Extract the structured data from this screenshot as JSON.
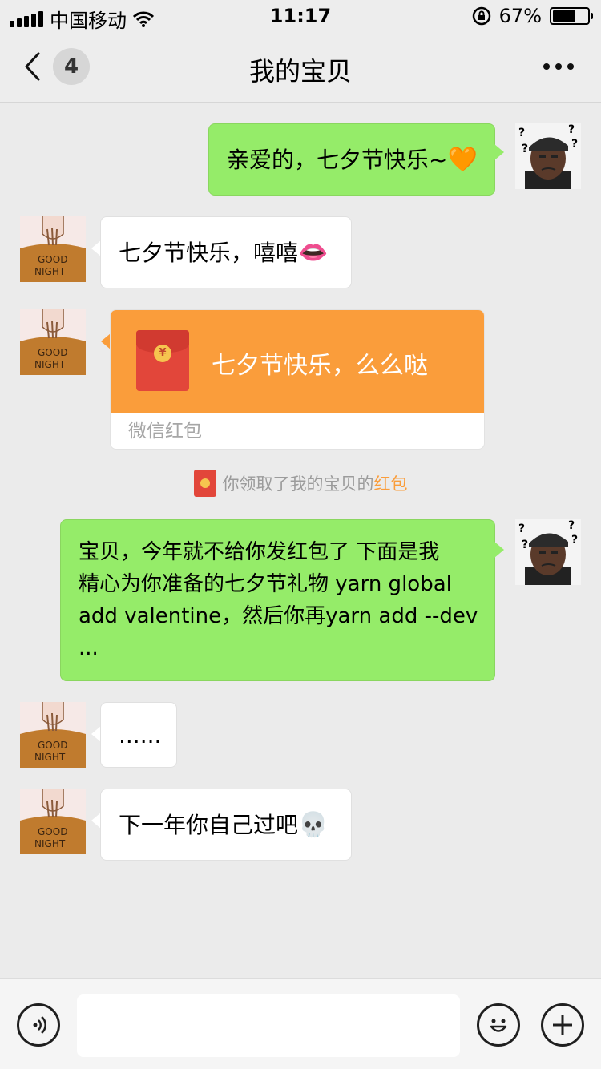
{
  "status_bar": {
    "carrier": "中国移动",
    "time": "11:17",
    "battery": "67%",
    "battery_level": 0.67,
    "icons": [
      "signal-icon",
      "wifi-icon",
      "rotation-lock-icon",
      "battery-icon"
    ]
  },
  "nav": {
    "title": "我的宝贝",
    "back_badge": "4",
    "icons": [
      "chevron-left-icon",
      "more-icon"
    ]
  },
  "messages": [
    {
      "side": "right",
      "type": "text",
      "text": "亲爱的，七夕节快乐~",
      "emoji": "🧡"
    },
    {
      "side": "left",
      "type": "text",
      "text": "七夕节快乐，嘻嘻",
      "emoji": "👄"
    },
    {
      "side": "left",
      "type": "red_packet",
      "text": "七夕节快乐，么么哒",
      "footer": "微信红包"
    },
    {
      "side": "right",
      "type": "text",
      "lines": [
        "宝贝，今年就不给你发红包了 下面是我",
        "精心为你准备的七夕节礼物 yarn global",
        "add valentine，然后你再yarn add --dev",
        "..."
      ]
    },
    {
      "side": "left",
      "type": "text",
      "text": "......"
    },
    {
      "side": "left",
      "type": "text",
      "text": "下一年你自己过吧",
      "emoji": "💀"
    }
  ],
  "system_note": {
    "prefix": "你领取了我的宝贝的",
    "highlight": "红包"
  },
  "avatar_text": {
    "line1": "GOOD",
    "line2": "NIGHT"
  },
  "input_bar": {
    "placeholder": "",
    "icons": [
      "voice-icon",
      "emoji-icon",
      "plus-icon"
    ]
  },
  "colors": {
    "green_bubble": "#95ec69",
    "red_packet": "#fa9d3b",
    "background": "#ebebeb"
  }
}
